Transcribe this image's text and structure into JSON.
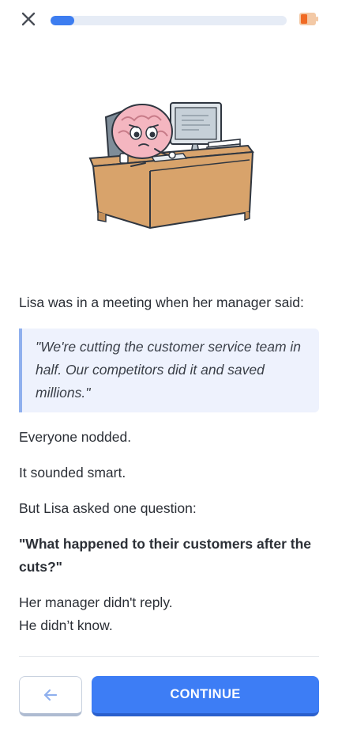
{
  "header": {
    "close_icon": "close-icon",
    "progress": 0.1,
    "battery_icon": "battery-icon"
  },
  "illustration": {
    "icon": "brain-at-desk-illustration"
  },
  "story": {
    "intro": "Lisa was in a meeting when her manager said:",
    "quote": "\"We're cutting the customer service team in half. Our competitors did it and saved millions.\"",
    "p1": "Everyone nodded.",
    "p2": "It sounded smart.",
    "p3": "But Lisa asked one question:",
    "p4": "\"What happened to their customers after the cuts?\"",
    "p5_line1": "Her manager didn't reply.",
    "p5_line2": "He didn’t know."
  },
  "footer": {
    "back_icon": "arrow-left-icon",
    "continue_label": "CONTINUE"
  },
  "colors": {
    "accent": "#3d7df5",
    "progress_track": "#e6ecf6",
    "quote_bg": "#eef2fd",
    "quote_border": "#8fb0ee"
  }
}
